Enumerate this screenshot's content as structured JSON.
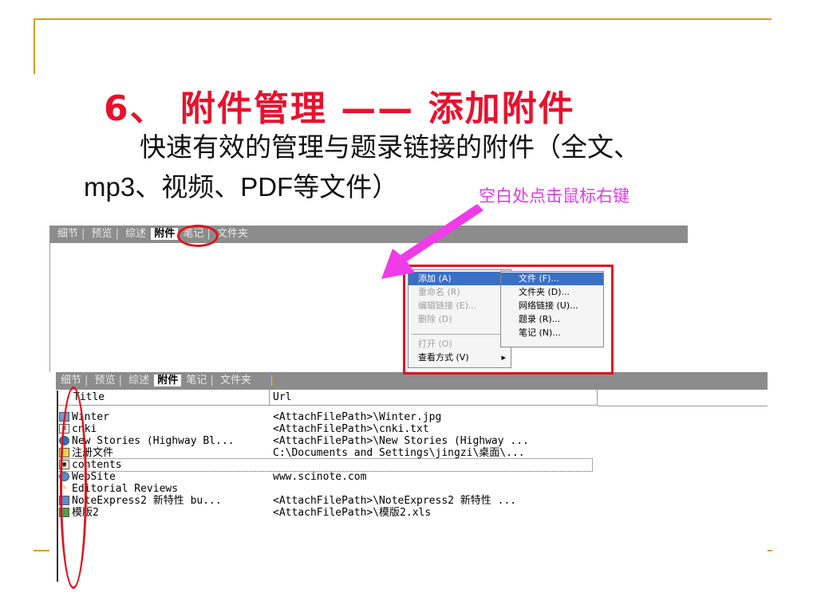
{
  "slide": {
    "title": "6、 附件管理 —— 添加附件",
    "body_line1": "快速有效的管理与题录链接的附件（全文、",
    "body_line2": "mp3、视频、PDF等文件）",
    "callout": "空白处点击鼠标右键"
  },
  "tabs_top": [
    "细节",
    "预览",
    "综述",
    "附件",
    "笔记",
    "文件夹"
  ],
  "tabs_bottom": [
    "细节",
    "预览",
    "综述",
    "附件",
    "笔记",
    "文件夹"
  ],
  "active_tab": "附件",
  "context_menu": {
    "items": [
      {
        "label": "添加 (A)",
        "enabled": true,
        "submenu": true,
        "highlighted": true
      },
      {
        "label": "重命名 (R)",
        "enabled": false
      },
      {
        "label": "编辑链接 (E)...",
        "enabled": false
      },
      {
        "label": "删除 (D)",
        "enabled": false
      },
      {
        "label": "打开 (O)",
        "enabled": false
      },
      {
        "label": "查看方式 (V)",
        "enabled": true,
        "submenu": true
      }
    ],
    "submenu_items": [
      "文件 (F)...",
      "文件夹 (D)...",
      "网络链接 (U)...",
      "题录 (R)...",
      "笔记 (N)..."
    ]
  },
  "table": {
    "columns": [
      "Title",
      "Url"
    ],
    "column_headers_visible": [
      "Title",
      "Url"
    ],
    "rows": [
      {
        "icon": "image-file-icon",
        "title": "Winter",
        "url": "<AttachFilePath>\\Winter.jpg"
      },
      {
        "icon": "text-file-icon",
        "title": "cnki",
        "url": "<AttachFilePath>\\cnki.txt"
      },
      {
        "icon": "media-file-icon",
        "title": "New Stories (Highway Bl...",
        "url": "<AttachFilePath>\\New Stories (Highway ..."
      },
      {
        "icon": "folder-icon",
        "title": "注册文件",
        "url": "C:\\Documents and Settings\\jingzi\\桌面\\..."
      },
      {
        "icon": "note-icon",
        "title": "contents",
        "url": ""
      },
      {
        "icon": "web-link-icon",
        "title": "WebSite",
        "url": "www.scinote.com"
      },
      {
        "icon": "pencil-icon",
        "title": "Editorial Reviews",
        "url": ""
      },
      {
        "icon": "word-file-icon",
        "title": "NoteExpress2 新特性 bu...",
        "url": "<AttachFilePath>\\NoteExpress2 新特性 ..."
      },
      {
        "icon": "excel-file-icon",
        "title": "模版2",
        "url": "<AttachFilePath>\\模版2.xls"
      }
    ]
  },
  "colors": {
    "title_red": "#e8112d",
    "callout_magenta": "#e23ae8",
    "highlight_red": "#e0141e",
    "accent_gold": "#d4a017",
    "arrow": "#ef3ce8"
  }
}
